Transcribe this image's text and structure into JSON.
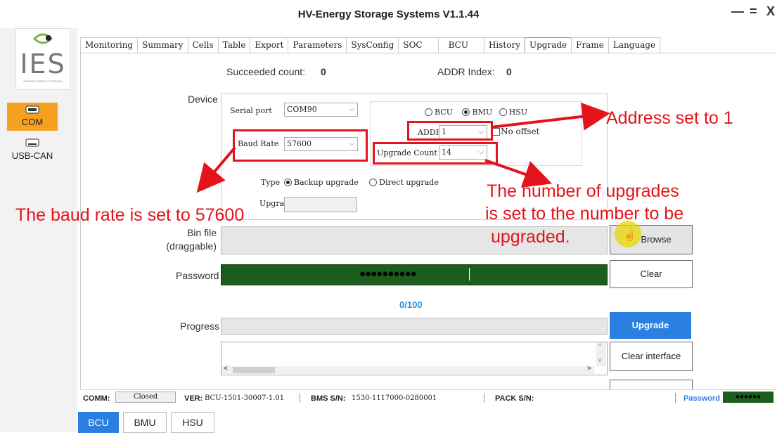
{
  "window": {
    "title": "HV-Energy Storage Systems V1.1.44",
    "minimize": "—",
    "maximize": "=",
    "close": "X"
  },
  "logo": {
    "text": "IES",
    "tagline": "INFINITE ENERGY STORAGE"
  },
  "sidebar": {
    "items": [
      {
        "label": "COM",
        "icon": "serial-port-icon",
        "active": true
      },
      {
        "label": "USB-CAN",
        "icon": "usb-can-icon",
        "active": false
      }
    ]
  },
  "tabs": [
    "Monitoring",
    "Summary",
    "Cells",
    "Table",
    "Export",
    "Parameters",
    "SysConfig",
    "SOC",
    "BCU",
    "History",
    "Upgrade",
    "Frame",
    "Language"
  ],
  "active_tab": "Upgrade",
  "upgrade": {
    "succeeded_label": "Succeeded count:",
    "succeeded_value": "0",
    "addr_index_label": "ADDR Index:",
    "addr_index_value": "0",
    "device_label": "Device",
    "serial_port_label": "Serial port",
    "serial_port_value": "COM90",
    "baud_rate_label": "Baud Rate",
    "baud_rate_value": "57600",
    "radio_bcu": "BCU",
    "radio_bmu": "BMU",
    "radio_hsu": "HSU",
    "selected_device": "BMU",
    "addr_label": "ADDR",
    "addr_value": "1",
    "no_offset_label": "No offset",
    "upgrade_count_label": "Upgrade Count",
    "upgrade_count_value": "14",
    "type_label": "Type",
    "type_backup": "Backup upgrade",
    "type_direct": "Direct upgrade",
    "selected_type": "Backup upgrade",
    "upgrating_label": "Upgrating",
    "bin_file_label": "Bin file\n(draggable)",
    "browse_label": "Browse",
    "password_label": "Password",
    "password_value": "●●●●●●●●●●",
    "clear_label": "Clear",
    "progress_text": "0/100",
    "progress_label": "Progress",
    "progress_fraction": 0,
    "upgrade_button": "Upgrade",
    "clear_interface_button": "Clear interface"
  },
  "annotations": {
    "address": "Address set to 1",
    "baud": "The baud rate is set to 57600",
    "count_line1": "The number of upgrades",
    "count_line2": "is set to the number to be",
    "count_line3": "upgraded."
  },
  "status": {
    "comm_label": "COMM:",
    "comm_value": "Closed",
    "ver_label": "VER:",
    "ver_value": "BCU-1501-30007-1.01",
    "bms_sn_label": "BMS S/N:",
    "bms_sn_value": "1530-1117000-0280001",
    "pack_sn_label": "PACK S/N:",
    "password_label": "Password",
    "password_dots": "●●●●●●"
  },
  "bottom_tabs": [
    "BCU",
    "BMU",
    "HSU"
  ],
  "colors": {
    "accent_orange": "#f5a020",
    "annotation_red": "#e3141b",
    "password_green": "#1c5c1c",
    "upgrade_blue": "#2b7fe0",
    "progress_blue": "#2b8ad6"
  }
}
